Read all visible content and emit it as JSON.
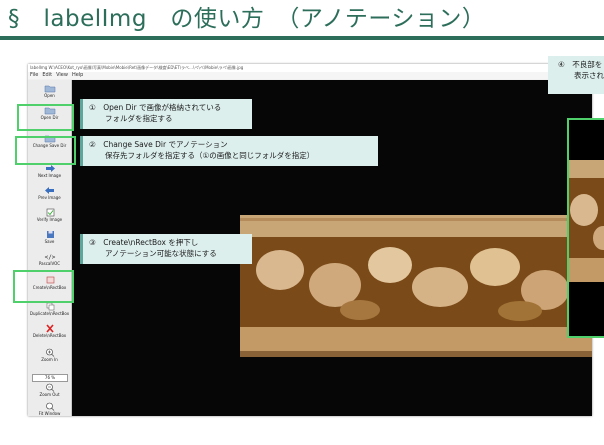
{
  "slide": {
    "title": "§　labelImg　の使い方　（アノテーション）"
  },
  "window": {
    "title": "labelImg W:\\ACEO\\Kot_ryo\\画像\\写真\\Mobie\\Mobie\\Ret\\画像データ\\検査\\ED\\ET\\ラベ…\\ベ\\ベ\\Mobie\\ラベ\\画像.jpg",
    "menu": [
      "File",
      "Edit",
      "View",
      "Help"
    ]
  },
  "toolbar": {
    "items": [
      {
        "label": "Open",
        "icon": "folder-open-icon"
      },
      {
        "label": "Open Dir",
        "icon": "folder-icon"
      },
      {
        "label": "Change Save Dir",
        "icon": "folder-save-icon"
      },
      {
        "label": "Next Image",
        "icon": "arrow-right-icon"
      },
      {
        "label": "Prev Image",
        "icon": "arrow-left-icon"
      },
      {
        "label": "Verify Image",
        "icon": "checkbox-icon"
      },
      {
        "label": "Save",
        "icon": "floppy-icon"
      },
      {
        "label": "PascalVOC",
        "icon": "code-icon"
      },
      {
        "label": "Create\\nRectBox",
        "icon": "rect-box-icon"
      },
      {
        "label": "Duplicate\\nRectBox",
        "icon": "copy-icon"
      },
      {
        "label": "Delete\\nRectBox",
        "icon": "delete-icon"
      },
      {
        "label": "Zoom In",
        "icon": "zoom-in-icon"
      },
      {
        "label": "Zoom Out",
        "icon": "zoom-out-icon"
      },
      {
        "label": "Fit Window",
        "icon": "fit-window-icon"
      }
    ],
    "zoom_value": "76 %"
  },
  "callouts": {
    "c1": {
      "line1": "①　Open Dir で画像が格納されている",
      "line2": "フォルダを指定する"
    },
    "c2": {
      "line1": "②　Change Save Dir でアノテーション",
      "line2": "保存先フォルダを指定する（①の画像と同じフォルダを指定）"
    },
    "c3": {
      "line1": "③　Create\\nRectBox を押下し",
      "line2": "アノテーション可能な状態にする"
    },
    "c4": {
      "line1": "④　不良部を",
      "line2": "表示され"
    }
  },
  "colors": {
    "title": "#2d6e5b",
    "highlight": "#4fd06b",
    "callout_bg": "#dcefed",
    "canvas_bg": "#060606"
  }
}
